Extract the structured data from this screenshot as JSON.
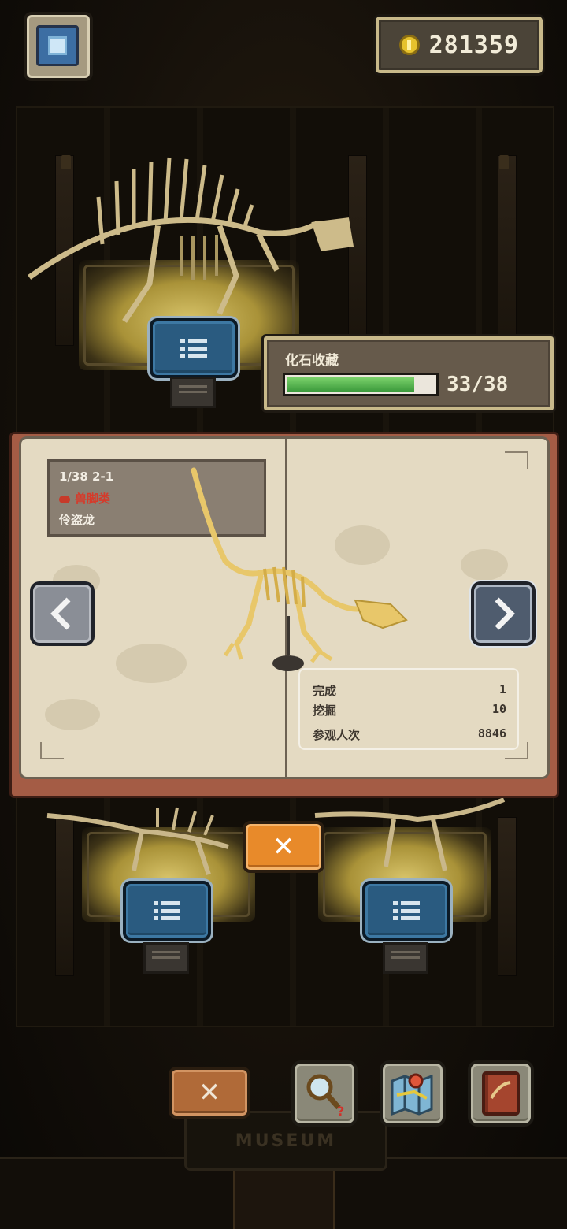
{
  "hud": {
    "coins": "281359",
    "camera_icon": "camera-icon",
    "coin_icon": "coin-icon"
  },
  "collection": {
    "title": "化石收藏",
    "progress_text": "33/38",
    "progress": 0.868,
    "bar_color": "#4fb04a"
  },
  "fossil": {
    "index_line": "1/38 2-1",
    "category": "兽脚类",
    "category_color": "#d63a2a",
    "name": "伶盗龙",
    "stats": [
      {
        "label": "完成",
        "value": "1"
      },
      {
        "label": "挖掘",
        "value": "10"
      },
      {
        "label": "参观人次",
        "value": "8846"
      }
    ]
  },
  "buttons": {
    "close_book": "✕",
    "close_bottom": "✕",
    "prev": "chevron-left-icon",
    "next": "chevron-right-icon",
    "list": "list-icon",
    "tools": [
      "magnifier-icon",
      "map-icon",
      "journal-icon"
    ]
  },
  "building": {
    "sign": "MUSEUM"
  },
  "colors": {
    "orange": "#e88a2a",
    "blue_button": "#2a5b80",
    "page": "#e4dac2",
    "book_cover": "#a45c45",
    "bone": "#e8c76a"
  }
}
